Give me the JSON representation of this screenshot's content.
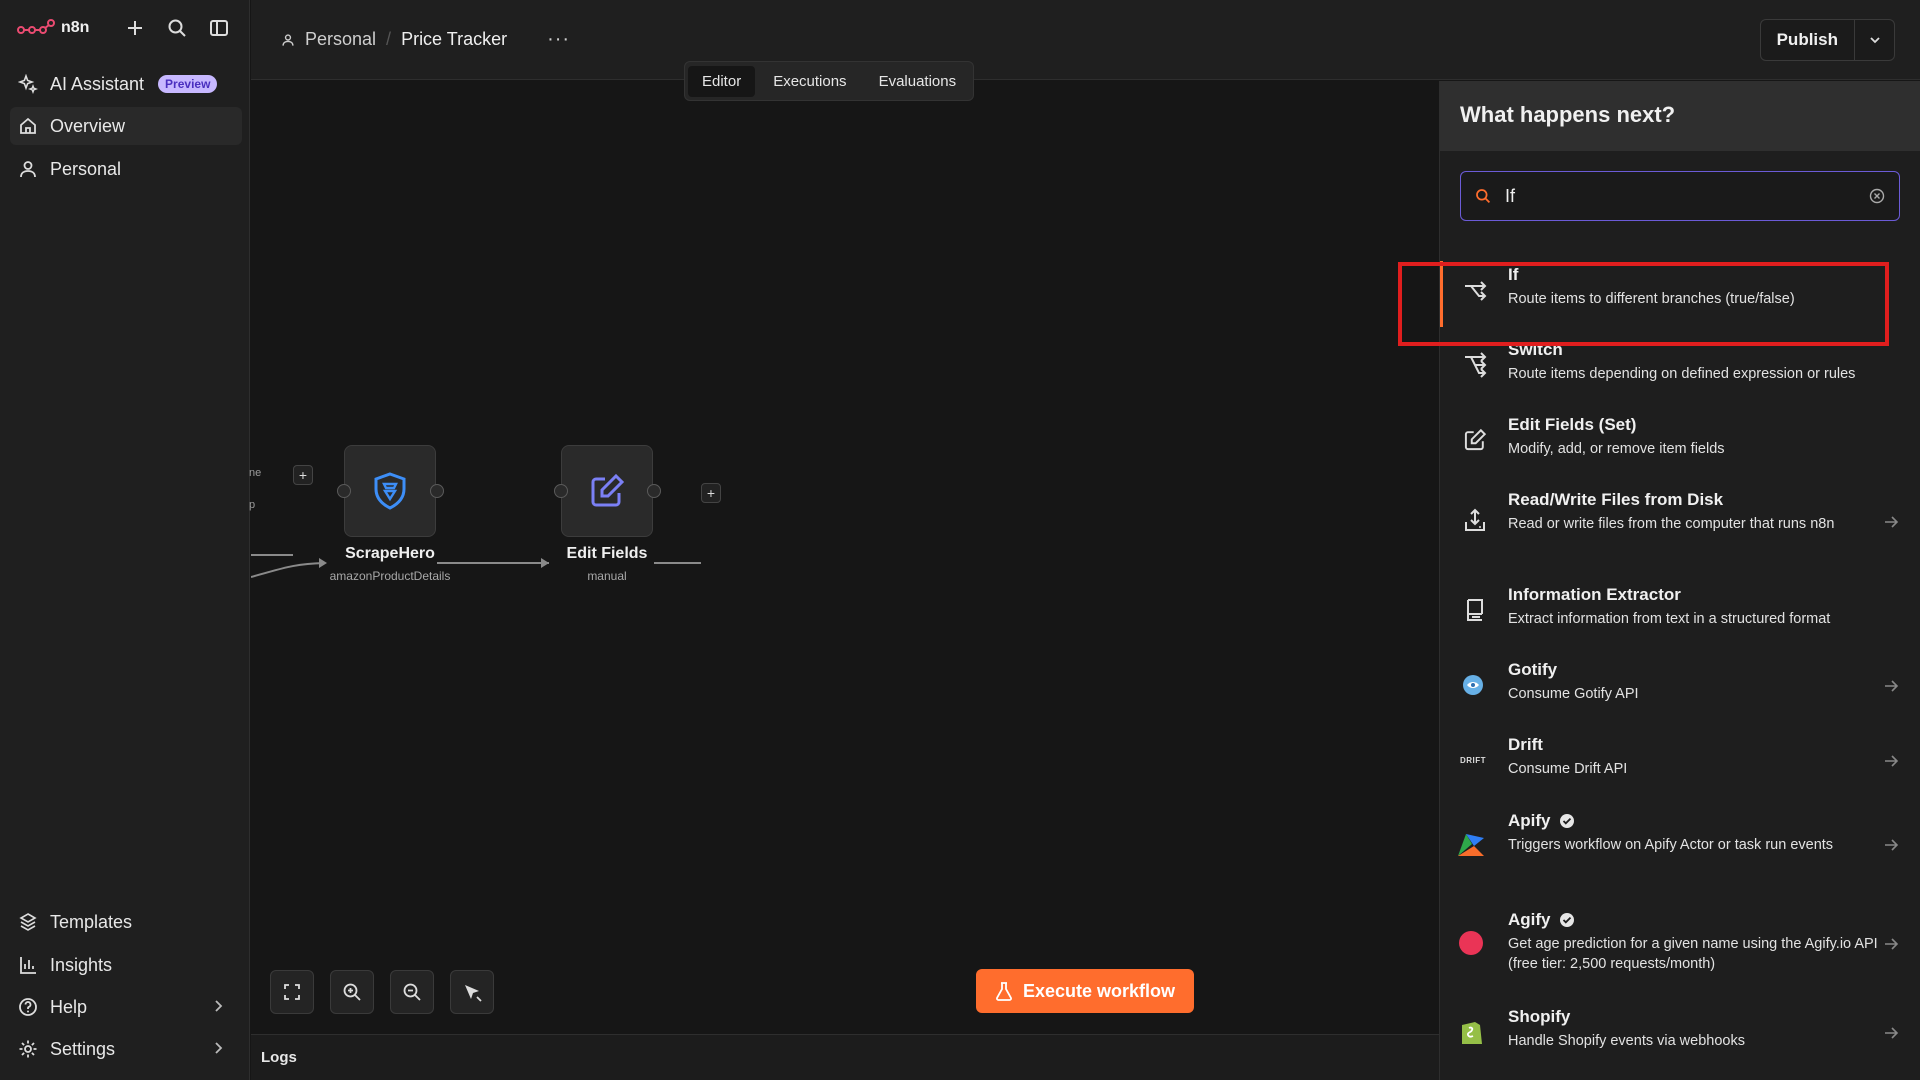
{
  "app": {
    "logo_text": "n8n",
    "accent": "#ff6d2d",
    "highlight_color": "#e01e1e"
  },
  "sidebar": {
    "top_items": [
      {
        "label": "AI Assistant",
        "badge": "Preview",
        "icon": "sparkles-icon"
      },
      {
        "label": "Overview",
        "icon": "home-icon"
      },
      {
        "label": "Personal",
        "icon": "user-icon"
      }
    ],
    "bottom_items": [
      {
        "label": "Templates",
        "icon": "templates-icon"
      },
      {
        "label": "Insights",
        "icon": "chart-icon"
      },
      {
        "label": "Help",
        "icon": "help-icon"
      },
      {
        "label": "Settings",
        "icon": "gear-icon"
      }
    ]
  },
  "header": {
    "breadcrumb_project": "Personal",
    "breadcrumb_title": "Price Tracker",
    "more": "···",
    "tabs": [
      "Editor",
      "Executions",
      "Evaluations"
    ],
    "active_tab": "Editor",
    "publish_label": "Publish"
  },
  "canvas": {
    "nodes": [
      {
        "name": "ScrapeHero",
        "subtitle": "amazonProductDetails",
        "icon": "shield-icon"
      },
      {
        "name": "Edit Fields",
        "subtitle": "manual",
        "icon": "edit-icon"
      }
    ],
    "edge_labels": [
      "ne",
      "p"
    ],
    "execute_label": "Execute workflow",
    "logs_label": "Logs"
  },
  "panel": {
    "title": "What happens next?",
    "search_value": "If",
    "items": [
      {
        "name": "If",
        "desc": "Route items to different branches (true/false)",
        "icon": "if-branch-icon",
        "arrow": false,
        "verified": false
      },
      {
        "name": "Switch",
        "desc": "Route items depending on defined expression or rules",
        "icon": "switch-icon",
        "arrow": false,
        "verified": false
      },
      {
        "name": "Edit Fields (Set)",
        "desc": "Modify, add, or remove item fields",
        "icon": "edit-icon",
        "arrow": false,
        "verified": false
      },
      {
        "name": "Read/Write Files from Disk",
        "desc": "Read or write files from the computer that runs n8n",
        "icon": "file-disk-icon",
        "arrow": true,
        "verified": false
      },
      {
        "name": "Information Extractor",
        "desc": "Extract information from text in a structured format",
        "icon": "extractor-icon",
        "arrow": false,
        "verified": false
      },
      {
        "name": "Gotify",
        "desc": "Consume Gotify API",
        "icon": "gotify-icon",
        "arrow": true,
        "verified": false
      },
      {
        "name": "Drift",
        "desc": "Consume Drift API",
        "icon": "drift-icon",
        "icon_text": "DRIFT",
        "arrow": true,
        "verified": false
      },
      {
        "name": "Apify",
        "desc": "Triggers workflow on Apify Actor or task run events",
        "icon": "apify-icon",
        "arrow": true,
        "verified": true
      },
      {
        "name": "Agify",
        "desc": "Get age prediction for a given name using the Agify.io API (free tier: 2,500 requests/month)",
        "icon": "agify-icon",
        "arrow": true,
        "verified": true
      },
      {
        "name": "Shopify",
        "desc": "Handle Shopify events via webhooks",
        "icon": "shopify-icon",
        "arrow": true,
        "verified": false
      }
    ]
  }
}
